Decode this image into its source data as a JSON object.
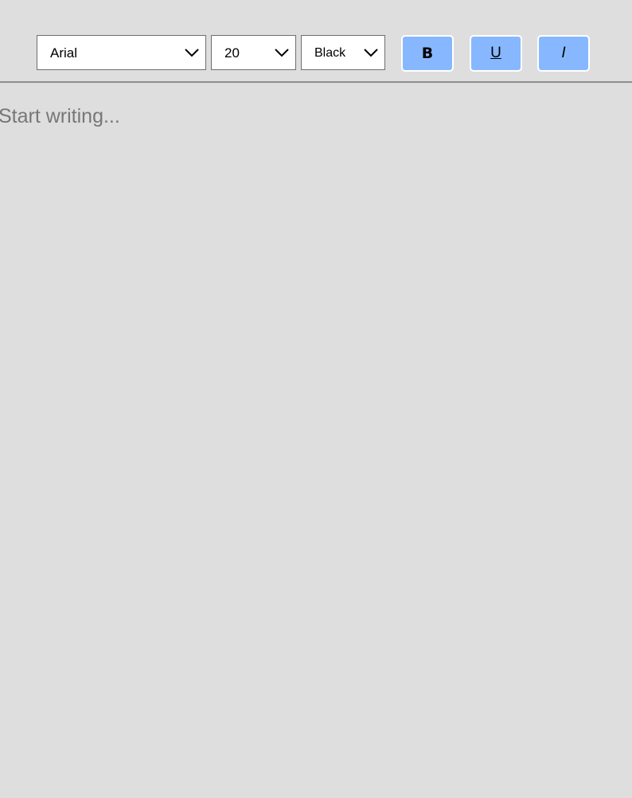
{
  "toolbar": {
    "font_family": {
      "selected": "Arial"
    },
    "font_size": {
      "selected": "20"
    },
    "font_color": {
      "selected": "Black"
    },
    "bold_label": "B",
    "underline_label": "U",
    "italic_label": "I",
    "button_color": "#87b8ff"
  },
  "editor": {
    "placeholder": "Start writing..."
  },
  "icons": {
    "dropdown": "chevron-down-icon"
  }
}
